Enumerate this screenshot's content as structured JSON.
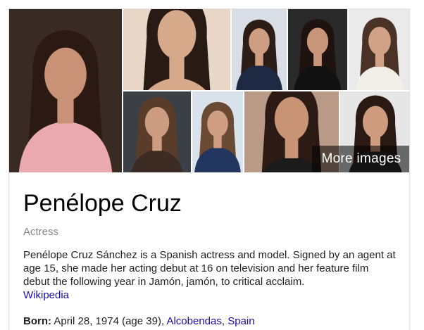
{
  "entity": {
    "name": "Penélope Cruz",
    "subtitle": "Actress",
    "description": "Penélope Cruz Sánchez is a Spanish actress and model. Signed by an agent at age 15, she made her acting debut at 16 on television and her feature film debut the following year in Jamón, jamón, to critical acclaim.",
    "source_link": "Wikipedia"
  },
  "images": {
    "more_label": "More images",
    "tiles": [
      {
        "name": "image-tile-1",
        "bg": "#3a2a24",
        "skin": "#c99277",
        "hair": "#2b1a14",
        "outfit": "#e9a9ae"
      },
      {
        "name": "image-tile-2",
        "bg": "#e8d7c6",
        "skin": "#d6a98b",
        "hair": "#2a1a14",
        "outfit": "#d6a98b"
      },
      {
        "name": "image-tile-3",
        "bg": "#d8dde6",
        "skin": "#cf9e82",
        "hair": "#2e1d16",
        "outfit": "#1e2a44"
      },
      {
        "name": "image-tile-4",
        "bg": "#2a2a2a",
        "skin": "#c9957a",
        "hair": "#1e130f",
        "outfit": "#111111"
      },
      {
        "name": "image-tile-5",
        "bg": "#eaeaea",
        "skin": "#d2a287",
        "hair": "#4a3326",
        "outfit": "#f2efe9"
      },
      {
        "name": "image-tile-6",
        "bg": "#3b3f46",
        "skin": "#cc9b80",
        "hair": "#5a3c2a",
        "outfit": "#3c2c24"
      },
      {
        "name": "image-tile-7",
        "bg": "#d9e1ea",
        "skin": "#d09e83",
        "hair": "#6b4a33",
        "outfit": "#23365f"
      },
      {
        "name": "image-tile-8",
        "bg": "#b89a86",
        "skin": "#c99376",
        "hair": "#2b1b14",
        "outfit": "#1b1b1b"
      },
      {
        "name": "image-tile-9",
        "bg": "#e6e6e6",
        "skin": "#cf9b7f",
        "hair": "#2a1a13",
        "outfit": "#2a2a2a"
      }
    ]
  },
  "facts": [
    {
      "label": "Born:",
      "text": "April 28, 1974 (age 39),",
      "links": [
        "Alcobendas",
        "Spain"
      ],
      "separator": ", "
    }
  ]
}
